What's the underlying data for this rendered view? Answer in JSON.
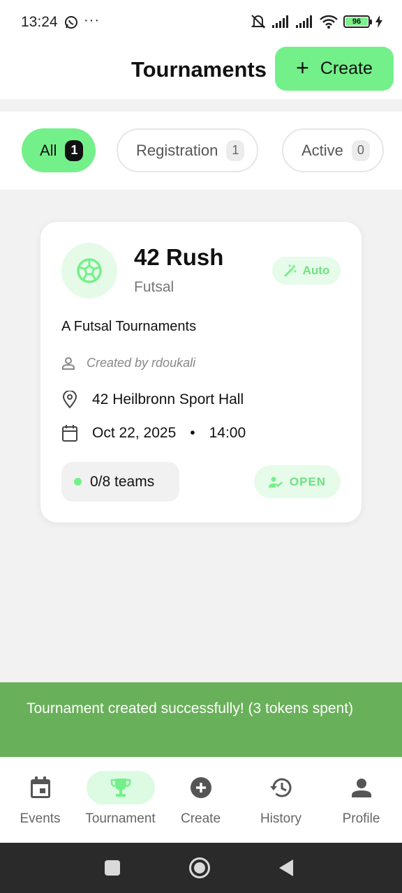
{
  "status_bar": {
    "time": "13:24",
    "battery": "96"
  },
  "header": {
    "title": "Tournaments",
    "create_label": "Create"
  },
  "filters": [
    {
      "label": "All",
      "count": "1"
    },
    {
      "label": "Registration",
      "count": "1"
    },
    {
      "label": "Active",
      "count": "0"
    }
  ],
  "card": {
    "title": "42 Rush",
    "sport": "Futsal",
    "mode_badge": "Auto",
    "description": "A Futsal Tournaments",
    "created_by": "Created by rdoukali",
    "location": "42 Heilbronn Sport Hall",
    "date": "Oct 22, 2025",
    "separator": "•",
    "time": "14:00",
    "teams": "0/8 teams",
    "status": "OPEN"
  },
  "snackbar": {
    "message": "Tournament created successfully! (3 tokens spent)"
  },
  "bottom_nav": [
    {
      "label": "Events",
      "icon": "calendar-icon"
    },
    {
      "label": "Tournament",
      "icon": "trophy-icon"
    },
    {
      "label": "Create",
      "icon": "add-circle-icon"
    },
    {
      "label": "History",
      "icon": "history-icon"
    },
    {
      "label": "Profile",
      "icon": "person-icon"
    }
  ],
  "colors": {
    "accent": "#74f08a",
    "accent_light": "#e6fbe9",
    "snackbar": "#69b05a",
    "system_nav": "#2a2a2a"
  }
}
